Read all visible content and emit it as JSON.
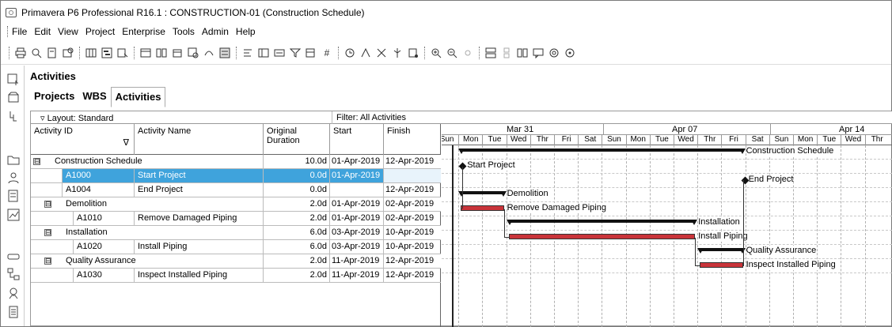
{
  "window": {
    "title": "Primavera P6 Professional R16.1 : CONSTRUCTION-01 (Construction Schedule)"
  },
  "menu": [
    "File",
    "Edit",
    "View",
    "Project",
    "Enterprise",
    "Tools",
    "Admin",
    "Help"
  ],
  "toolbar_icons": [
    "print-icon",
    "print-preview-icon",
    "page-setup-icon",
    "publish-icon",
    "columns-icon",
    "bars-icon",
    "chart-icon",
    "schedule-icon",
    "level-icon",
    "store-period-icon",
    "apply-actuals-icon",
    "update-progress-icon",
    "layout-icon",
    "group-sort-icon",
    "filter-icon",
    "view-icon",
    "number-icon",
    "clock-icon",
    "resources-icon",
    "tools-icon",
    "trace-icon",
    "reports-icon",
    "zoom-in-icon",
    "zoom-out-icon",
    "zoom-fit-icon",
    "split-icon",
    "collapse-icon",
    "pane-icon",
    "notes-icon",
    "steps-icon",
    "help-icon"
  ],
  "side_icons": [
    "add-icon",
    "open-icon",
    "wbs-icon",
    "folder-icon",
    "resource-icon",
    "project-icon",
    "report-icon",
    "tracking-icon",
    "hierarchy-icon",
    "user-icon",
    "document-icon"
  ],
  "section_title": "Activities",
  "tabs": [
    "Projects",
    "WBS",
    "Activities"
  ],
  "layout": {
    "label": "Layout: Standard",
    "filter": "Filter: All Activities"
  },
  "columns": {
    "id": "Activity ID",
    "name": "Activity Name",
    "duration": "Original Duration",
    "start": "Start",
    "finish": "Finish"
  },
  "rows": [
    {
      "type": "wbs",
      "expand": "⊟",
      "id": "Construction Schedule",
      "name": "",
      "duration": "10.0d",
      "start": "01-Apr-2019",
      "finish": "12-Apr-2019"
    },
    {
      "type": "act",
      "id": "A1000",
      "name": "Start Project",
      "duration": "0.0d",
      "start": "01-Apr-2019",
      "finish": "",
      "selected": true
    },
    {
      "type": "act",
      "id": "A1004",
      "name": "End Project",
      "duration": "0.0d",
      "start": "",
      "finish": "12-Apr-2019"
    },
    {
      "type": "wbs",
      "expand": "⊟",
      "id": "Demolition",
      "name": "",
      "duration": "2.0d",
      "start": "01-Apr-2019",
      "finish": "02-Apr-2019"
    },
    {
      "type": "act",
      "id": "A1010",
      "name": "Remove Damaged Piping",
      "duration": "2.0d",
      "start": "01-Apr-2019",
      "finish": "02-Apr-2019"
    },
    {
      "type": "wbs",
      "expand": "⊟",
      "id": "Installation",
      "name": "",
      "duration": "6.0d",
      "start": "03-Apr-2019",
      "finish": "10-Apr-2019"
    },
    {
      "type": "act",
      "id": "A1020",
      "name": "Install Piping",
      "duration": "6.0d",
      "start": "03-Apr-2019",
      "finish": "10-Apr-2019"
    },
    {
      "type": "wbs",
      "expand": "⊟",
      "id": "Quality Assurance",
      "name": "",
      "duration": "2.0d",
      "start": "11-Apr-2019",
      "finish": "12-Apr-2019"
    },
    {
      "type": "act",
      "id": "A1030",
      "name": "Inspect Installed Piping",
      "duration": "2.0d",
      "start": "11-Apr-2019",
      "finish": "12-Apr-2019"
    }
  ],
  "timeline": {
    "weeks": [
      "Mar 31",
      "Apr 07",
      "Apr 14"
    ],
    "days": [
      "Sun",
      "Mon",
      "Tue",
      "Wed",
      "Thr",
      "Fri",
      "Sat",
      "Sun",
      "Mon",
      "Tue",
      "Wed",
      "Thr",
      "Fri",
      "Sat",
      "Sun",
      "Mon",
      "Tue",
      "Wed",
      "Thr"
    ]
  },
  "bar_labels": [
    "Construction Schedule",
    "Start Project",
    "End Project",
    "Demolition",
    "Remove Damaged Piping",
    "Installation",
    "Install Piping",
    "Quality Assurance",
    "Inspect Installed Piping"
  ],
  "colors": {
    "selection": "#3fa3dc",
    "activity_bar": "#c9343a",
    "summary_bar": "#111111"
  }
}
